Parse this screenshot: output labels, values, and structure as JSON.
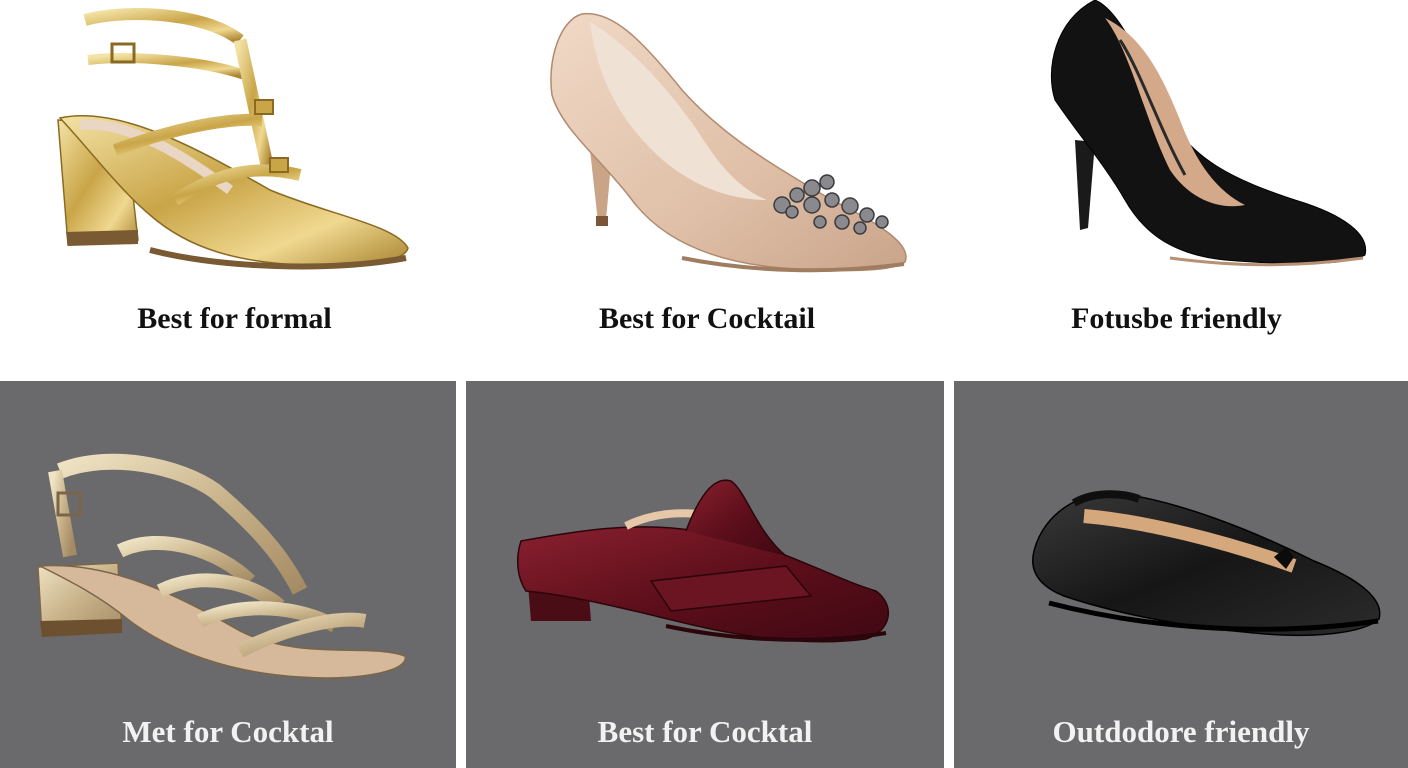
{
  "top_row": [
    {
      "caption": "Best for formal",
      "shoe": "gold-tstrap-block-heel-icon"
    },
    {
      "caption": "Best for Cocktail",
      "shoe": "nude-embellished-pump-icon"
    },
    {
      "caption": "Fotusbe friendly",
      "shoe": "black-suede-pump-icon"
    }
  ],
  "bottom_row": [
    {
      "caption": "Met for Cocktal",
      "shoe": "metallic-strappy-sandal-icon"
    },
    {
      "caption": "Best for Cocktal",
      "shoe": "burgundy-velvet-mule-icon"
    },
    {
      "caption": "Outdodore friendly",
      "shoe": "black-leather-ballet-flat-icon"
    }
  ],
  "colors": {
    "panel_bg_dark": "#6a6a6c",
    "panel_bg_light": "#ffffff",
    "gold": "#d8b960",
    "nude": "#e3c6b0",
    "black": "#111111",
    "burgundy": "#6d1420"
  }
}
